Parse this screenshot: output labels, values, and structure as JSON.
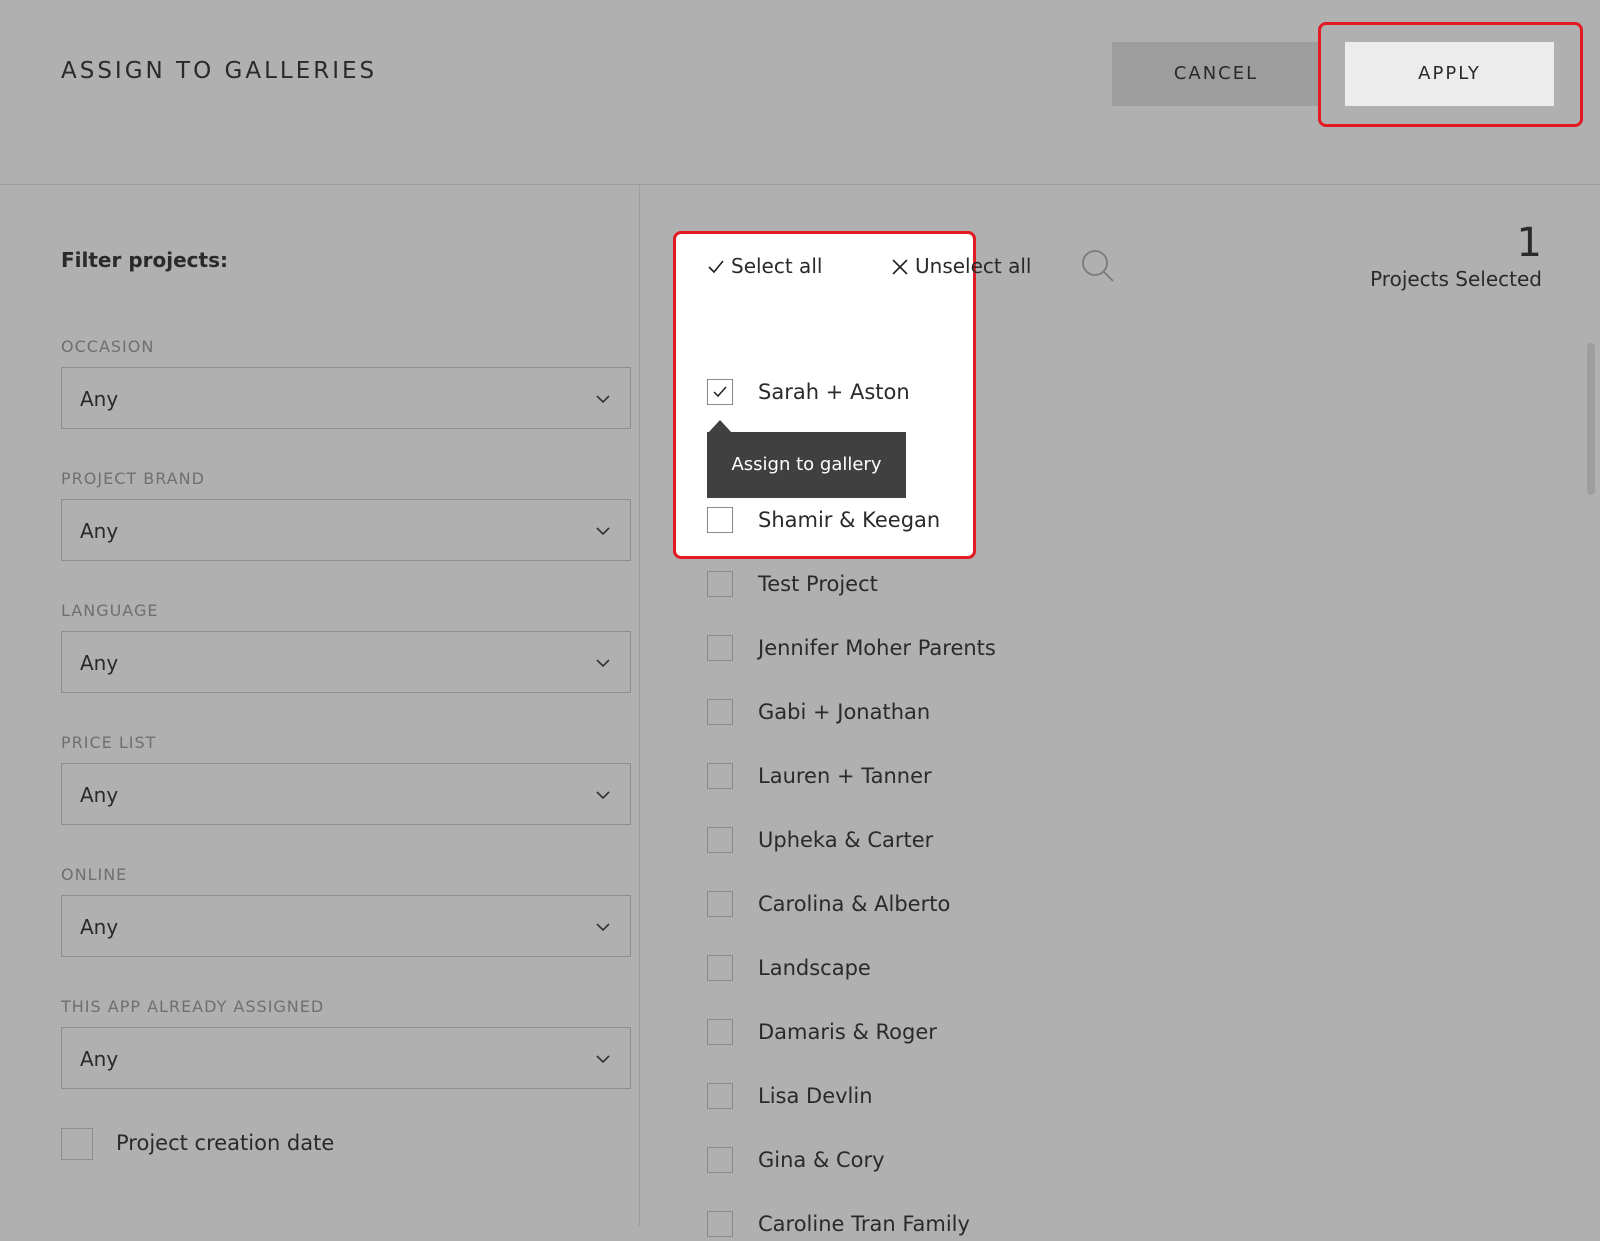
{
  "header": {
    "title": "ASSIGN TO GALLERIES",
    "cancel_label": "CANCEL",
    "apply_label": "APPLY"
  },
  "filters": {
    "heading": "Filter projects:",
    "occasion": {
      "label": "OCCASION",
      "value": "Any"
    },
    "project_brand": {
      "label": "PROJECT BRAND",
      "value": "Any"
    },
    "language": {
      "label": "LANGUAGE",
      "value": "Any"
    },
    "price_list": {
      "label": "PRICE LIST",
      "value": "Any"
    },
    "online": {
      "label": "ONLINE",
      "value": "Any"
    },
    "app_assigned": {
      "label": "THIS APP ALREADY ASSIGNED",
      "value": "Any"
    },
    "creation_date": {
      "label": "Project creation date",
      "checked": false
    }
  },
  "toolbar": {
    "select_all": "Select all",
    "unselect_all": "Unselect all",
    "selected_count": "1",
    "selected_label": "Projects Selected"
  },
  "tooltip": "Assign to gallery",
  "projects": [
    {
      "name": "Sarah + Aston",
      "checked": true
    },
    {
      "name": "Shamir & Keegan",
      "checked": false
    },
    {
      "name": "Test Project",
      "checked": false
    },
    {
      "name": "Jennifer Moher Parents",
      "checked": false
    },
    {
      "name": "Gabi + Jonathan",
      "checked": false
    },
    {
      "name": "Lauren + Tanner",
      "checked": false
    },
    {
      "name": "Upheka & Carter",
      "checked": false
    },
    {
      "name": "Carolina & Alberto",
      "checked": false
    },
    {
      "name": "Landscape",
      "checked": false
    },
    {
      "name": "Damaris & Roger",
      "checked": false
    },
    {
      "name": "Lisa Devlin",
      "checked": false
    },
    {
      "name": "Gina & Cory",
      "checked": false
    },
    {
      "name": "Caroline Tran Family",
      "checked": false
    }
  ],
  "colors": {
    "highlight": "#e11a23",
    "overlay": "#b0b0b0",
    "tooltip_bg": "#404040"
  },
  "icons": {
    "check": "check-icon",
    "close": "close-icon",
    "search": "search-icon",
    "chevron": "chevron-down-icon"
  }
}
